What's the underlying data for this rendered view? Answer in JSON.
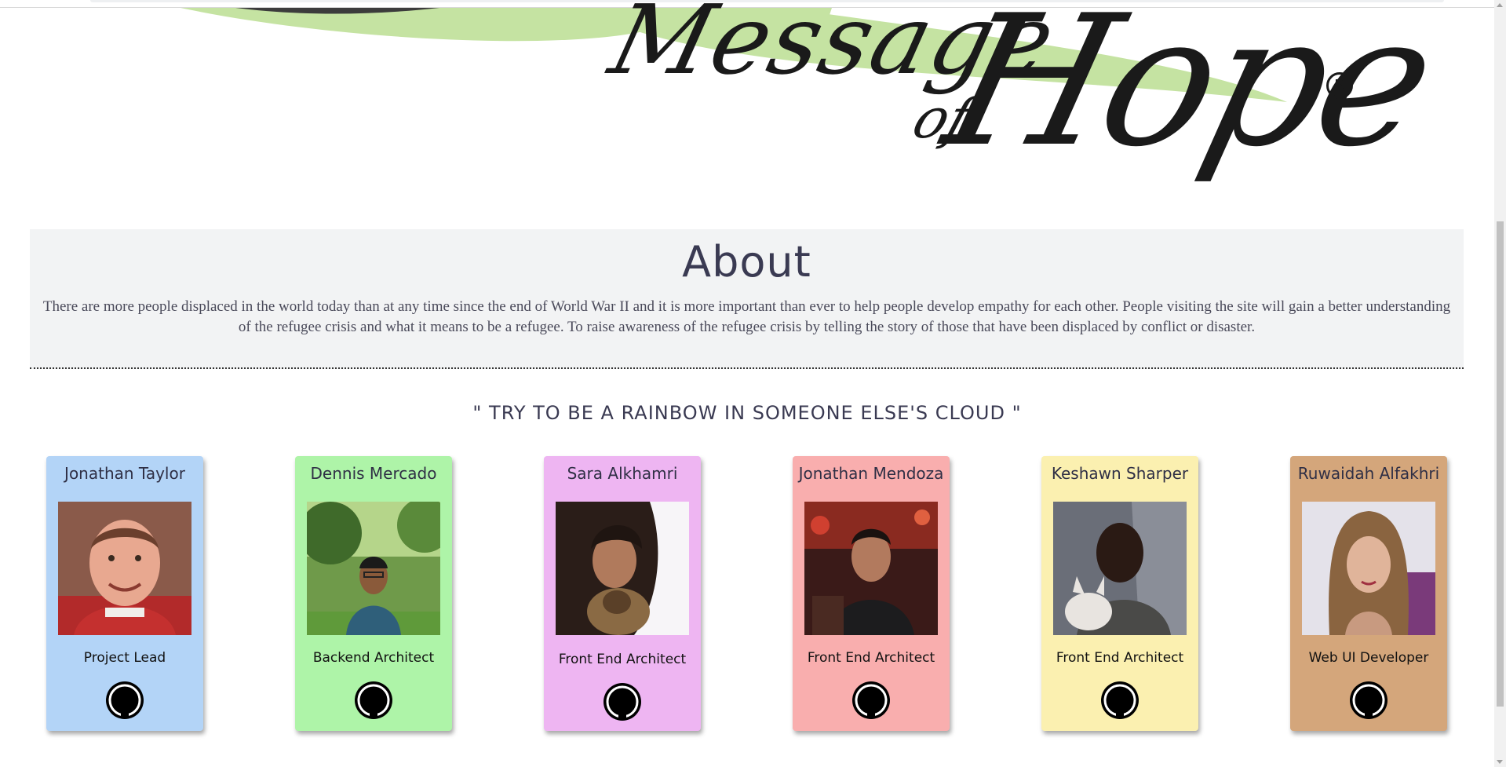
{
  "logo": {
    "word_message": "Message",
    "word_of": "of",
    "word_hope": "Hope",
    "registered_mark": "R",
    "colors": {
      "ink": "#1a1a1a",
      "leaf": "#c5e3a2"
    }
  },
  "about": {
    "title": "About",
    "body": "There are more people displaced in the world today than at any time since the end of World War II and it is more important than ever to help people develop empathy for each other. People visiting the site will gain a better understanding of the refugee crisis and what it means to be a refugee. To raise awareness of the refugee crisis by telling the story of those that have been displaced by conflict or disaster."
  },
  "quote": "\" TRY TO BE A RAINBOW IN SOMEONE ELSE'S CLOUD \"",
  "team": [
    {
      "name": "Jonathan Taylor",
      "role": "Project Lead",
      "color": "#b3d4f7",
      "icon": "github-icon"
    },
    {
      "name": "Dennis Mercado",
      "role": "Backend Architect",
      "color": "#aef4a8",
      "icon": "github-icon"
    },
    {
      "name": "Sara Alkhamri",
      "role": "Front End Architect",
      "color": "#eeb5f2",
      "icon": "github-icon"
    },
    {
      "name": "Jonathan Mendoza",
      "role": "Front End Architect",
      "color": "#f9aeae",
      "icon": "github-icon"
    },
    {
      "name": "Keshawn Sharper",
      "role": "Front End Architect",
      "color": "#fbf0b0",
      "icon": "github-icon"
    },
    {
      "name": "Ruwaidah Alfakhri",
      "role": "Web UI Developer",
      "color": "#d4a67b",
      "icon": "github-icon"
    }
  ]
}
